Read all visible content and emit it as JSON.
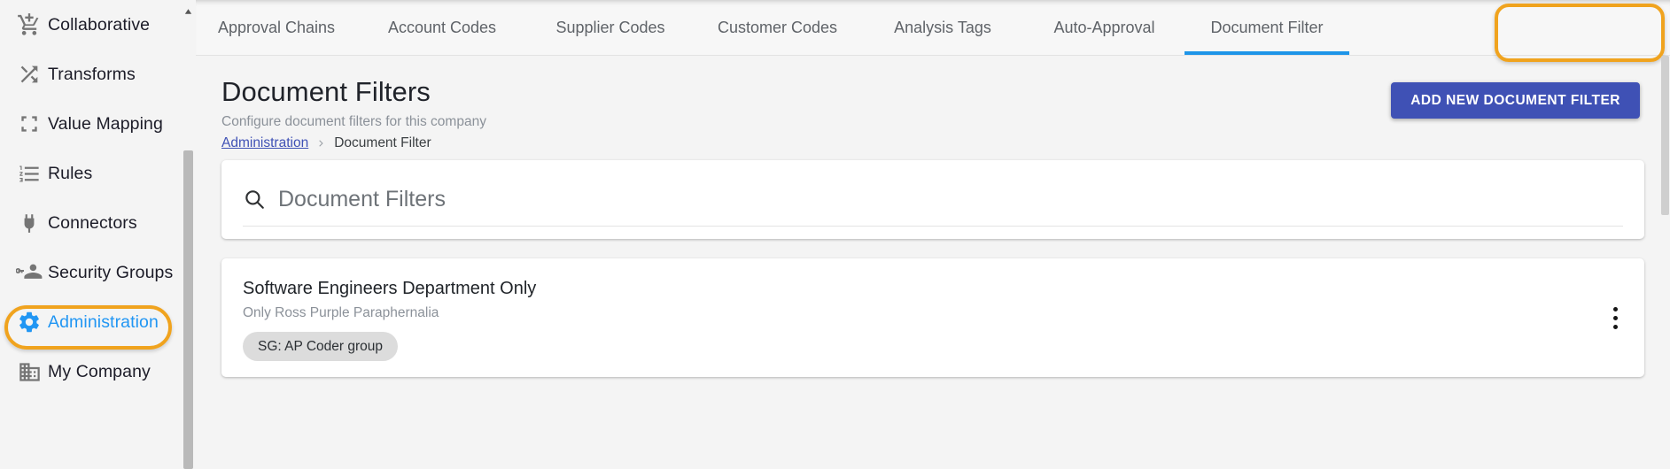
{
  "sidebar": {
    "items": [
      {
        "label": "Collaborative",
        "icon": "add-to-cart-icon",
        "active": false
      },
      {
        "label": "Transforms",
        "icon": "shuffle-icon",
        "active": false
      },
      {
        "label": "Value Mapping",
        "icon": "collapse-icon",
        "active": false
      },
      {
        "label": "Rules",
        "icon": "numbered-list-icon",
        "active": false
      },
      {
        "label": "Connectors",
        "icon": "plug-icon",
        "active": false
      },
      {
        "label": "Security Groups",
        "icon": "key-user-icon",
        "active": false
      },
      {
        "label": "Administration",
        "icon": "gear-icon",
        "active": true
      },
      {
        "label": "My Company",
        "icon": "building-icon",
        "active": false
      }
    ],
    "scroll_up_icon": "scroll-up-arrow-icon"
  },
  "tabs": [
    {
      "label": "Approval Chains",
      "active": false
    },
    {
      "label": "Account Codes",
      "active": false
    },
    {
      "label": "Supplier Codes",
      "active": false
    },
    {
      "label": "Customer Codes",
      "active": false
    },
    {
      "label": "Analysis Tags",
      "active": false
    },
    {
      "label": "Auto-Approval",
      "active": false
    },
    {
      "label": "Document Filter",
      "active": true
    }
  ],
  "page": {
    "title": "Document Filters",
    "subtitle": "Configure document filters for this company",
    "breadcrumb": {
      "link": "Administration",
      "separator": "›",
      "current": "Document Filter"
    },
    "add_button": "ADD NEW DOCUMENT FILTER"
  },
  "search": {
    "placeholder": "Document Filters",
    "value": "",
    "icon": "search-icon"
  },
  "filters": [
    {
      "title": "Software Engineers Department Only",
      "subtitle": "Only Ross Purple Paraphernalia",
      "chips": [
        "SG: AP Coder group"
      ],
      "menu_icon": "kebab-menu-icon"
    }
  ],
  "annotations": {
    "admin_highlight_color": "#f0a31e",
    "tab_highlight_color": "#f0a31e"
  },
  "colors": {
    "accent_blue": "#2196f3",
    "tab_underline": "#1e95e8",
    "primary_button": "#3f51b5",
    "link": "#3f51b5"
  }
}
